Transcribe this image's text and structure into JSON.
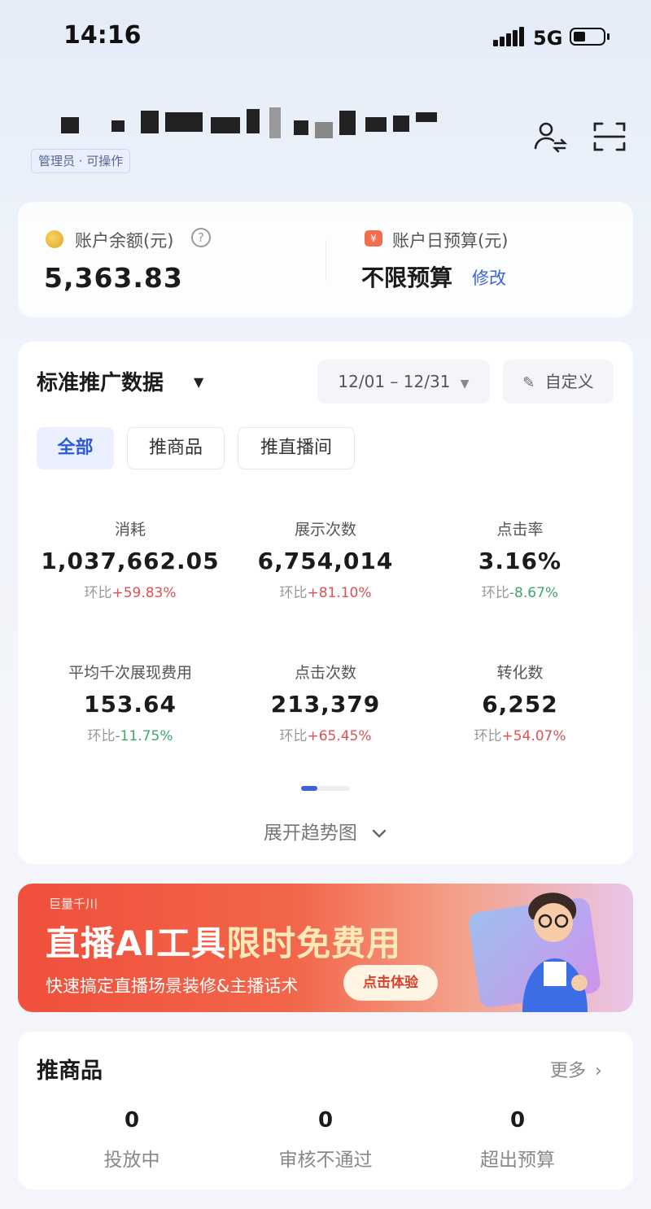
{
  "status_bar": {
    "time": "14:16",
    "network": "5G"
  },
  "header": {
    "account_name": "",
    "role_badge": "管理员 · 可操作"
  },
  "balance": {
    "label": "账户余额(元)",
    "value": "5,363.83",
    "budget_label": "账户日预算(元)",
    "budget_value": "不限预算",
    "modify_label": "修改"
  },
  "data_section": {
    "title": "标准推广数据",
    "date_range": "12/01 – 12/31",
    "custom_label": "自定义",
    "tabs": [
      {
        "label": "全部",
        "active": true
      },
      {
        "label": "推商品",
        "active": false
      },
      {
        "label": "推直播间",
        "active": false
      }
    ],
    "metrics": [
      {
        "label": "消耗",
        "value": "1,037,662.05",
        "change_prefix": "环比",
        "change": "+59.83%",
        "trend": "up"
      },
      {
        "label": "展示次数",
        "value": "6,754,014",
        "change_prefix": "环比",
        "change": "+81.10%",
        "trend": "up"
      },
      {
        "label": "点击率",
        "value": "3.16%",
        "change_prefix": "环比",
        "change": "-8.67%",
        "trend": "down"
      },
      {
        "label": "平均千次展现费用",
        "value": "153.64",
        "change_prefix": "环比",
        "change": "-11.75%",
        "trend": "down"
      },
      {
        "label": "点击次数",
        "value": "213,379",
        "change_prefix": "环比",
        "change": "+65.45%",
        "trend": "up"
      },
      {
        "label": "转化数",
        "value": "6,252",
        "change_prefix": "环比",
        "change": "+54.07%",
        "trend": "up"
      }
    ],
    "expand_label": "展开趋势图"
  },
  "banner": {
    "logo": "巨量千川",
    "title_a": "直播AI工具",
    "title_b": "限时免费用",
    "subtitle": "快速搞定直播场景装修&主播话术",
    "button": "点击体验"
  },
  "products": {
    "title": "推商品",
    "more_label": "更多",
    "stats": [
      {
        "value": "0",
        "label": "投放中"
      },
      {
        "value": "0",
        "label": "审核不通过"
      },
      {
        "value": "0",
        "label": "超出预算"
      }
    ]
  },
  "colors": {
    "accent": "#3c63d6",
    "up": "#e05151",
    "down": "#3fa86a",
    "banner": "#f04f3b"
  }
}
